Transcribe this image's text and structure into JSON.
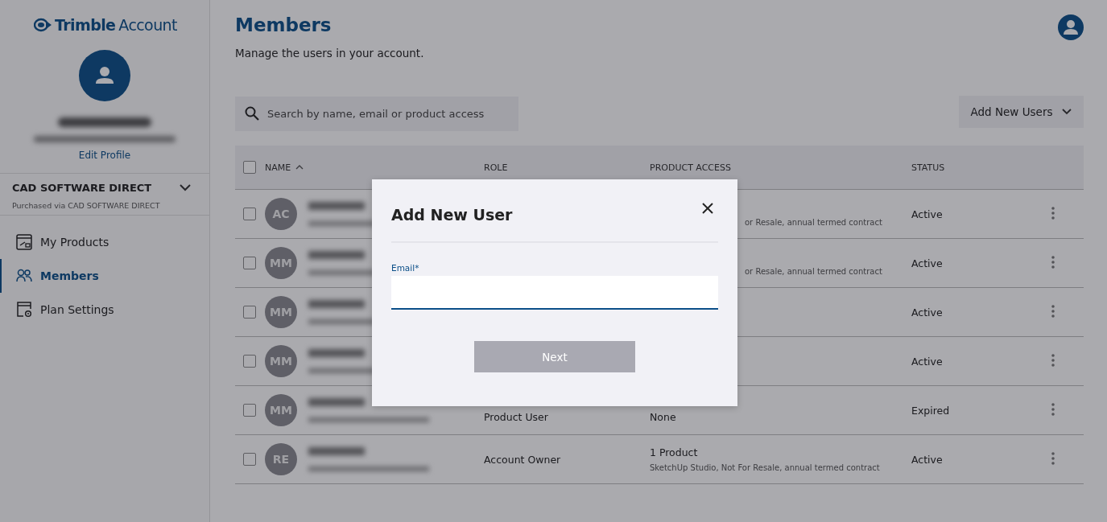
{
  "brand": {
    "name": "Trimble",
    "suffix": "Account"
  },
  "profile": {
    "link": "Edit Profile"
  },
  "account": {
    "name": "CAD SOFTWARE DIRECT",
    "subtitle": "Purchased via CAD SOFTWARE DIRECT"
  },
  "nav": [
    {
      "label": "My Products",
      "selected": false
    },
    {
      "label": "Members",
      "selected": true
    },
    {
      "label": "Plan Settings",
      "selected": false
    }
  ],
  "page": {
    "title": "Members",
    "subtitle": "Manage the users in your account."
  },
  "search": {
    "placeholder": "Search by name, email or product access"
  },
  "add_button": "Add New Users",
  "table": {
    "select_all_checked": false,
    "columns": [
      {
        "label": "NAME",
        "sorted": true
      },
      {
        "label": "ROLE",
        "sorted": false
      },
      {
        "label": "PRODUCT ACCESS",
        "sorted": false
      },
      {
        "label": "STATUS",
        "sorted": false
      }
    ],
    "rows": [
      {
        "initials": "AC",
        "checked": false,
        "detail": "or Resale, annual termed contract",
        "status": "Active"
      },
      {
        "initials": "MM",
        "checked": false,
        "detail": "or Resale, annual termed contract",
        "status": "Active"
      },
      {
        "initials": "MM",
        "checked": false,
        "status": "Active"
      },
      {
        "initials": "MM",
        "checked": false,
        "status": "Active"
      },
      {
        "initials": "MM",
        "checked": false,
        "role": "Product User",
        "product": "None",
        "status": "Expired"
      },
      {
        "initials": "RE",
        "checked": false,
        "role": "Account Owner",
        "product": "1 Product",
        "detail": "SketchUp Studio, Not For Resale, annual termed contract",
        "status": "Active"
      }
    ]
  },
  "dialog": {
    "title": "Add New User",
    "field_label": "Email*",
    "button": "Next",
    "button_disabled": true
  }
}
